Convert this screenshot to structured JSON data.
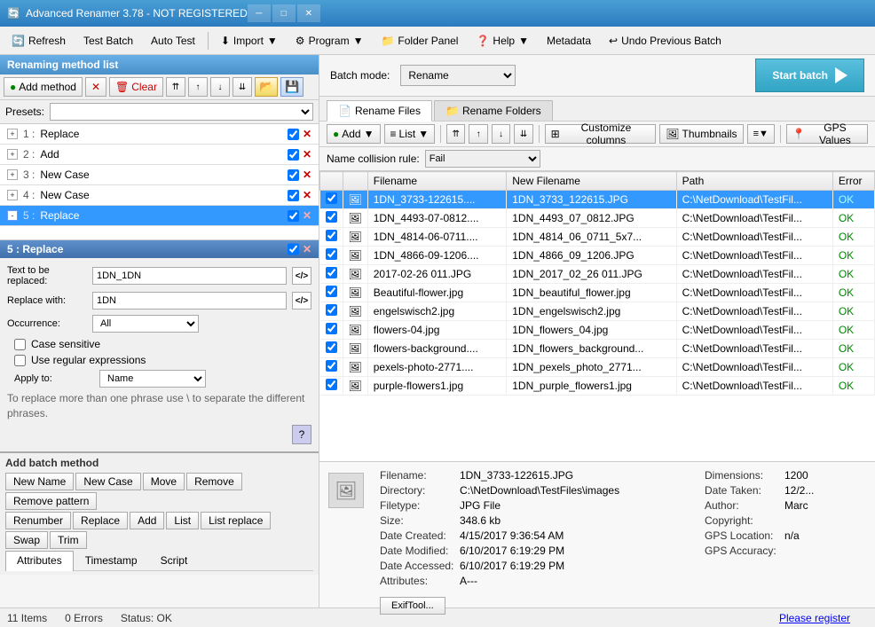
{
  "titlebar": {
    "title": "Advanced Renamer 3.78 - NOT REGISTERED",
    "icon": "🔄"
  },
  "menubar": {
    "refresh_label": "Refresh",
    "test_batch_label": "Test Batch",
    "auto_test_label": "Auto Test",
    "import_label": "Import",
    "program_label": "Program",
    "folder_panel_label": "Folder Panel",
    "help_label": "Help",
    "metadata_label": "Metadata",
    "undo_label": "Undo Previous Batch"
  },
  "left_panel": {
    "header": "Renaming method list",
    "add_method_label": "Add method",
    "clear_label": "Clear",
    "presets_label": "Presets:",
    "methods": [
      {
        "num": "1",
        "name": "Replace",
        "checked": true
      },
      {
        "num": "2",
        "name": "Add",
        "checked": true
      },
      {
        "num": "3",
        "name": "New Case",
        "checked": true
      },
      {
        "num": "4",
        "name": "New Case",
        "checked": true
      },
      {
        "num": "5",
        "name": "Replace",
        "checked": true,
        "active": true
      }
    ]
  },
  "method_detail": {
    "title": "5 : Replace",
    "text_to_replace_label": "Text to be replaced:",
    "text_to_replace_value": "1DN_1DN",
    "replace_with_label": "Replace with:",
    "replace_with_value": "1DN",
    "occurrence_label": "Occurrence:",
    "occurrence_value": "All",
    "case_sensitive_label": "Case sensitive",
    "use_regex_label": "Use regular expressions",
    "apply_to_label": "Apply to:",
    "apply_to_value": "Name",
    "help_note": "To replace more than one phrase use \\ to separate the different phrases."
  },
  "add_batch_method": {
    "title": "Add batch method",
    "row1": [
      "New Name",
      "New Case",
      "Move",
      "Remove",
      "Remove pattern"
    ],
    "row2": [
      "Renumber",
      "Replace",
      "Add",
      "List",
      "List replace",
      "Swap",
      "Trim"
    ],
    "tabs": [
      "Attributes",
      "Timestamp",
      "Script"
    ]
  },
  "right_panel": {
    "batch_mode_label": "Batch mode:",
    "batch_mode_value": "Rename",
    "start_batch_label": "Start batch",
    "rename_files_tab": "Rename Files",
    "rename_folders_tab": "Rename Folders",
    "add_label": "Add",
    "list_label": "List",
    "customize_columns_label": "Customize columns",
    "thumbnails_label": "Thumbnails",
    "gps_values_label": "GPS Values",
    "collision_label": "Name collision rule:",
    "collision_value": "Fail",
    "table_headers": [
      "Filename",
      "New Filename",
      "Path",
      "Error"
    ],
    "files": [
      {
        "filename": "1DN_3733-122615....",
        "new_filename": "1DN_3733_122615.JPG",
        "path": "C:\\NetDownload\\TestFil...",
        "status": "OK",
        "selected": true
      },
      {
        "filename": "1DN_4493-07-0812....",
        "new_filename": "1DN_4493_07_0812.JPG",
        "path": "C:\\NetDownload\\TestFil...",
        "status": "OK"
      },
      {
        "filename": "1DN_4814-06-0711....",
        "new_filename": "1DN_4814_06_0711_5x7...",
        "path": "C:\\NetDownload\\TestFil...",
        "status": "OK"
      },
      {
        "filename": "1DN_4866-09-1206....",
        "new_filename": "1DN_4866_09_1206.JPG",
        "path": "C:\\NetDownload\\TestFil...",
        "status": "OK"
      },
      {
        "filename": "2017-02-26 011.JPG",
        "new_filename": "1DN_2017_02_26 011.JPG",
        "path": "C:\\NetDownload\\TestFil...",
        "status": "OK"
      },
      {
        "filename": "Beautiful-flower.jpg",
        "new_filename": "1DN_beautiful_flower.jpg",
        "path": "C:\\NetDownload\\TestFil...",
        "status": "OK"
      },
      {
        "filename": "engelswisch2.jpg",
        "new_filename": "1DN_engelswisch2.jpg",
        "path": "C:\\NetDownload\\TestFil...",
        "status": "OK"
      },
      {
        "filename": "flowers-04.jpg",
        "new_filename": "1DN_flowers_04.jpg",
        "path": "C:\\NetDownload\\TestFil...",
        "status": "OK"
      },
      {
        "filename": "flowers-background....",
        "new_filename": "1DN_flowers_background...",
        "path": "C:\\NetDownload\\TestFil...",
        "status": "OK"
      },
      {
        "filename": "pexels-photo-2771....",
        "new_filename": "1DN_pexels_photo_2771...",
        "path": "C:\\NetDownload\\TestFil...",
        "status": "OK"
      },
      {
        "filename": "purple-flowers1.jpg",
        "new_filename": "1DN_purple_flowers1.jpg",
        "path": "C:\\NetDownload\\TestFil...",
        "status": "OK"
      }
    ]
  },
  "file_info": {
    "filename_label": "Filename:",
    "filename_value": "1DN_3733-122615.JPG",
    "directory_label": "Directory:",
    "directory_value": "C:\\NetDownload\\TestFiles\\images",
    "filetype_label": "Filetype:",
    "filetype_value": "JPG File",
    "size_label": "Size:",
    "size_value": "348.6 kb",
    "date_created_label": "Date Created:",
    "date_created_value": "4/15/2017 9:36:54 AM",
    "date_modified_label": "Date Modified:",
    "date_modified_value": "6/10/2017 6:19:29 PM",
    "date_accessed_label": "Date Accessed:",
    "date_accessed_value": "6/10/2017 6:19:29 PM",
    "attributes_label": "Attributes:",
    "attributes_value": "A---",
    "dimensions_label": "Dimensions:",
    "dimensions_value": "1200",
    "date_taken_label": "Date Taken:",
    "date_taken_value": "12/2...",
    "author_label": "Author:",
    "author_value": "Marc",
    "copyright_label": "Copyright:",
    "copyright_value": "",
    "gps_location_label": "GPS Location:",
    "gps_location_value": "n/a",
    "gps_accuracy_label": "GPS Accuracy:",
    "gps_accuracy_value": "",
    "exif_btn_label": "ExifTool..."
  },
  "statusbar": {
    "items_label": "11 Items",
    "errors_label": "0 Errors",
    "status_label": "Status: OK",
    "register_link": "Please register"
  }
}
